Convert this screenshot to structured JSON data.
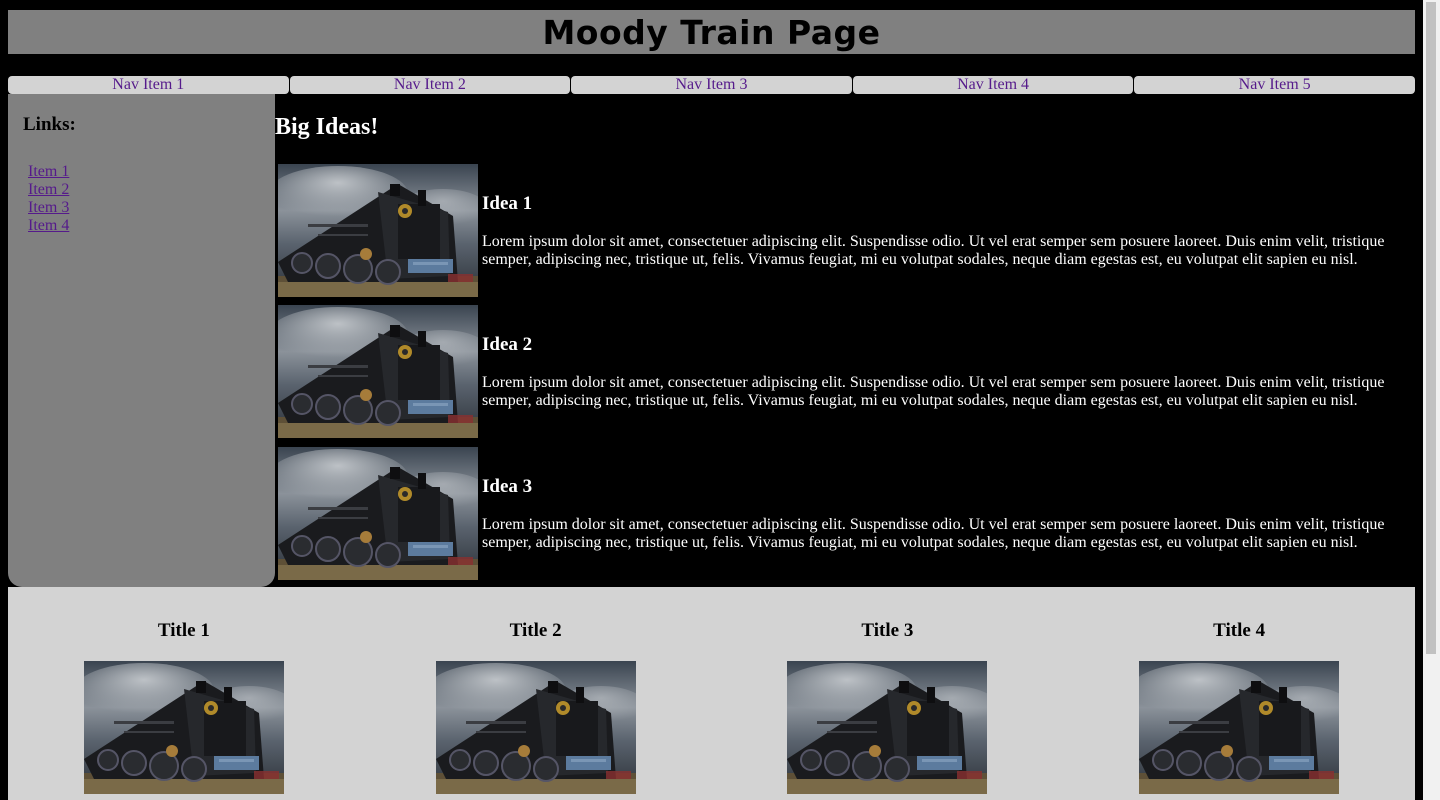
{
  "header": {
    "title": "Moody Train Page"
  },
  "nav": {
    "items": [
      "Nav Item 1",
      "Nav Item 2",
      "Nav Item 3",
      "Nav Item 4",
      "Nav Item 5"
    ]
  },
  "sidebar": {
    "heading": "Links:",
    "links": [
      "Item 1",
      "Item 2",
      "Item 3",
      "Item 4"
    ]
  },
  "main": {
    "heading": "Big Ideas!",
    "ideas": [
      {
        "title": "Idea 1",
        "text": "Lorem ipsum dolor sit amet, consectetuer adipiscing elit. Suspendisse odio. Ut vel erat semper sem posuere laoreet. Duis enim velit, tristique semper, adipiscing nec, tristique ut, felis. Vivamus feugiat, mi eu volutpat sodales, neque diam egestas est, eu volutpat elit sapien eu nisl."
      },
      {
        "title": "Idea 2",
        "text": "Lorem ipsum dolor sit amet, consectetuer adipiscing elit. Suspendisse odio. Ut vel erat semper sem posuere laoreet. Duis enim velit, tristique semper, adipiscing nec, tristique ut, felis. Vivamus feugiat, mi eu volutpat sodales, neque diam egestas est, eu volutpat elit sapien eu nisl."
      },
      {
        "title": "Idea 3",
        "text": "Lorem ipsum dolor sit amet, consectetuer adipiscing elit. Suspendisse odio. Ut vel erat semper sem posuere laoreet. Duis enim velit, tristique semper, adipiscing nec, tristique ut, felis. Vivamus feugiat, mi eu volutpat sodales, neque diam egestas est, eu volutpat elit sapien eu nisl."
      }
    ]
  },
  "footer": {
    "titles": [
      "Title 1",
      "Title 2",
      "Title 3",
      "Title 4"
    ]
  },
  "colors": {
    "header_bg": "#808080",
    "nav_bg": "#d3d3d3",
    "link": "#551a8b",
    "page_bg": "#000000",
    "footer_bg": "#d3d3d3"
  }
}
